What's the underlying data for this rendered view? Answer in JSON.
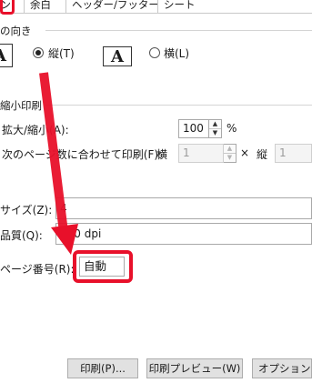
{
  "tabs": {
    "active_label": "ン",
    "items": [
      "余白",
      "ヘッダー/フッター",
      "シート"
    ]
  },
  "orientation": {
    "section_label": "の向き",
    "portrait_label": "縦(T)",
    "landscape_label": "横(L)",
    "icon_letter": "A",
    "selected": "portrait"
  },
  "scaling": {
    "section_label": "縮小印刷",
    "zoom_label": "拡大/縮小(A):",
    "zoom_value": "100",
    "zoom_unit": "%",
    "fit_label": "次のページ数に合わせて印刷(F):",
    "fit_wide_label": "横",
    "fit_wide_value": "1",
    "fit_times": "×",
    "fit_tall_label": "縦",
    "fit_tall_value": "1"
  },
  "paper": {
    "size_label": "サイズ(Z):",
    "size_value": "4",
    "quality_label": "品質(Q):",
    "quality_value": "600 dpi"
  },
  "page_number": {
    "label": "ページ番号(R):",
    "value": "自動"
  },
  "buttons": {
    "print": "印刷(P)...",
    "preview": "印刷プレビュー(W)",
    "options": "オプション(O)"
  },
  "colors": {
    "highlight": "#e8102a",
    "arrow": "#e8102a"
  }
}
